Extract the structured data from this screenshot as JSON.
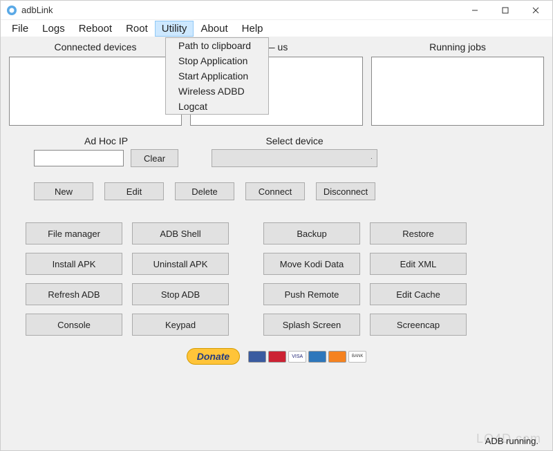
{
  "window": {
    "title": "adbLink",
    "minimize": "−",
    "maximize": "□",
    "close": "×"
  },
  "menu": {
    "items": [
      "File",
      "Logs",
      "Reboot",
      "Root",
      "Utility",
      "About",
      "Help"
    ],
    "open_index": 4,
    "dropdown": [
      "Path to clipboard",
      "Stop Application",
      "Start Application",
      "Wireless ADBD",
      "Logcat"
    ]
  },
  "panels": {
    "connected": "Connected devices",
    "wifi": "— us",
    "running": "Running jobs"
  },
  "adhoc": {
    "label": "Ad Hoc IP",
    "value": "",
    "clear": "Clear"
  },
  "selectdev": {
    "label": "Select device",
    "value": ""
  },
  "devbuttons": [
    "New",
    "Edit",
    "Delete",
    "Connect",
    "Disconnect"
  ],
  "grid": {
    "left": [
      [
        "File manager",
        "ADB Shell"
      ],
      [
        "Install APK",
        "Uninstall APK"
      ],
      [
        "Refresh ADB",
        "Stop ADB"
      ],
      [
        "Console",
        "Keypad"
      ]
    ],
    "right": [
      [
        "Backup",
        "Restore"
      ],
      [
        "Move Kodi Data",
        "Edit XML"
      ],
      [
        "Push Remote",
        "Edit Cache"
      ],
      [
        "Splash Screen",
        "Screencap"
      ]
    ]
  },
  "donate": {
    "label": "Donate"
  },
  "status": "ADB running.",
  "watermark": "LO4D.com"
}
